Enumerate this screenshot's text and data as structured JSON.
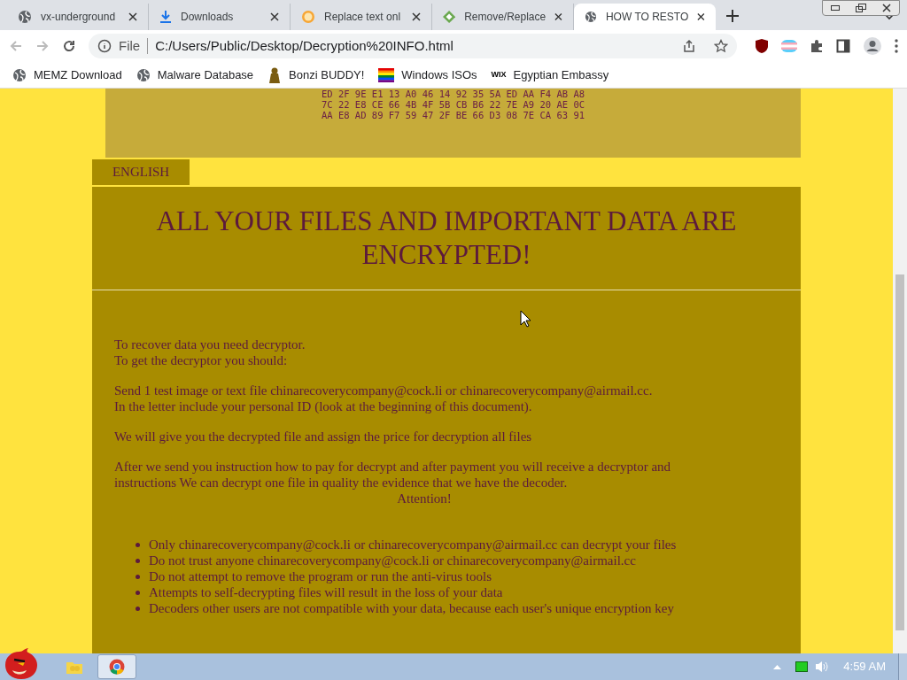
{
  "tabs": [
    {
      "title": "vx-underground",
      "selected": false
    },
    {
      "title": "Downloads",
      "selected": false
    },
    {
      "title": "Replace text onl",
      "selected": false
    },
    {
      "title": "Remove/Replace",
      "selected": false
    },
    {
      "title": "HOW TO RESTO",
      "selected": true
    }
  ],
  "address_bar": {
    "scheme": "File",
    "url": "C:/Users/Public/Desktop/Decryption%20INFO.html"
  },
  "bookmarks": [
    {
      "label": "MEMZ Download"
    },
    {
      "label": "Malware Database"
    },
    {
      "label": "Bonzi BUDDY!"
    },
    {
      "label": "Windows ISOs"
    },
    {
      "label": "Egyptian Embassy",
      "logo_text": "WIX"
    }
  ],
  "page": {
    "key_lines": [
      "ED 2F 9E E1 13 A0 46 14 92 35 5A ED AA F4 AB A8",
      "7C 22 E8 CE 66 4B 4F 5B CB B6 22 7E A9 20 AE 0C",
      "AA E8 AD 89 F7 59 47 2F BE 66 D3 08 7E CA 63 91"
    ],
    "language_tab": "ENGLISH",
    "heading": "ALL YOUR FILES AND IMPORTANT DATA ARE ENCRYPTED!",
    "paragraphs": [
      [
        "To recover data you need decryptor.",
        "To get the decryptor you should:"
      ],
      [
        "Send 1 test image or text file chinarecoverycompany@cock.li or chinarecoverycompany@airmail.cc.",
        "In the letter include your personal ID (look at the beginning of this document)."
      ],
      [
        "We will give you the decrypted file and assign the price for decryption all files"
      ],
      [
        "After we send you instruction how to pay for decrypt and after payment you will receive a decryptor and",
        "instructions We can decrypt one file in quality the evidence that we have the decoder."
      ]
    ],
    "attention": "Attention!",
    "bullets": [
      "Only chinarecoverycompany@cock.li or chinarecoverycompany@airmail.cc can decrypt your files",
      "Do not trust anyone chinarecoverycompany@cock.li or chinarecoverycompany@airmail.cc",
      "Do not attempt to remove the program or run the anti-virus tools",
      "Attempts to self-decrypting files will result in the loss of your data",
      "Decoders other users are not compatible with your data, because each user's unique encryption key"
    ]
  },
  "taskbar": {
    "clock": "4:59 AM"
  }
}
